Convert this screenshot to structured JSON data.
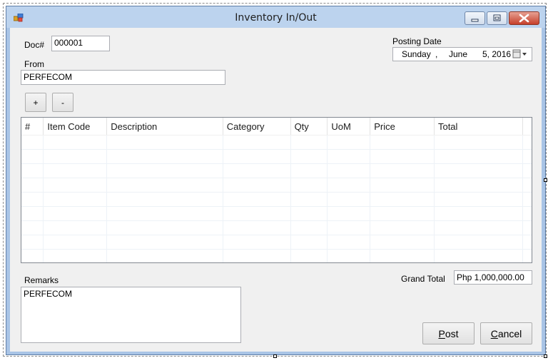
{
  "window": {
    "title": "Inventory In/Out"
  },
  "form": {
    "doc_label": "Doc#",
    "doc_value": "000001",
    "from_label": "From",
    "from_value": "PERFECOM",
    "add_label": "+",
    "remove_label": "-",
    "posting_date_label": "Posting Date",
    "posting_date": {
      "day": "Sunday",
      "sep": ",",
      "month": "June",
      "date_year": "5, 2016"
    },
    "remarks_label": "Remarks",
    "remarks_value": "PERFECOM",
    "grand_total_label": "Grand Total",
    "grand_total_value": "Php 1,000,000.00",
    "post_label": "Post",
    "post_mnemonic": "P",
    "post_rest": "ost",
    "cancel_label": "Cancel",
    "cancel_mnemonic": "C",
    "cancel_rest": "ancel"
  },
  "grid": {
    "columns": [
      "#",
      "Item Code",
      "Description",
      "Category",
      "Qty",
      "UoM",
      "Price",
      "Total"
    ],
    "rows": []
  }
}
